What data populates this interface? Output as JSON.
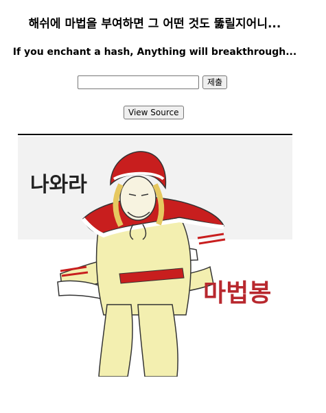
{
  "page": {
    "title": "해쉬에 마법을 부여하면 그 어떤 것도 뚫릴지어니...",
    "subtitle": "If you enchant a hash, Anything will breakthrough..."
  },
  "form": {
    "input_value": "",
    "submit_label": "제출"
  },
  "view_source_label": "View Source",
  "meme": {
    "top_text": "나와라",
    "bottom_text": "마법봉"
  }
}
